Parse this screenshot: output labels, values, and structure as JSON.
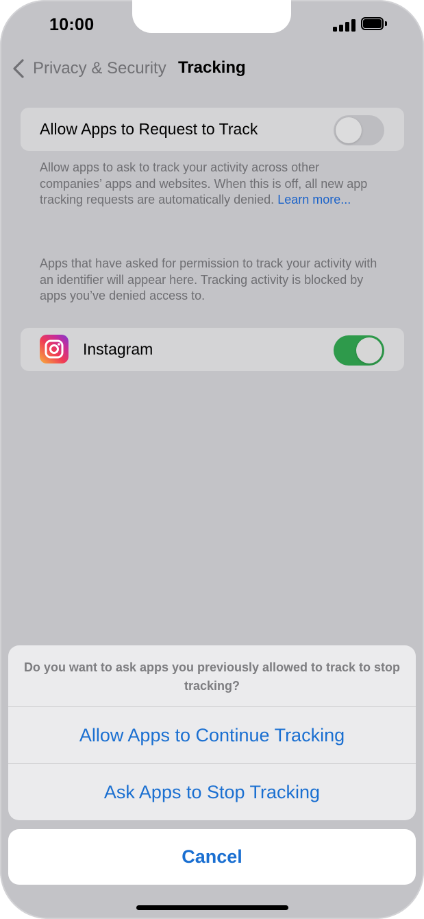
{
  "status_bar": {
    "time": "10:00",
    "signal_icon": "cellular-signal-icon",
    "battery_icon": "battery-full-icon"
  },
  "nav": {
    "back_label": "Privacy & Security",
    "title": "Tracking",
    "back_icon": "chevron-left-icon"
  },
  "allow_request": {
    "label": "Allow Apps to Request to Track",
    "enabled": false,
    "footnote": "Allow apps to ask to track your activity across other companies’ apps and websites. When this is off, all new app tracking requests are automatically denied. ",
    "learn_more": "Learn more..."
  },
  "apps_section": {
    "footnote": "Apps that have asked for permission to track your activity with an identifier will appear here. Tracking activity is blocked by apps you’ve denied access to.",
    "apps": [
      {
        "name": "Instagram",
        "icon": "instagram-icon",
        "enabled": true
      }
    ]
  },
  "action_sheet": {
    "message": "Do you want to ask apps you previously allowed to track to stop tracking?",
    "actions": [
      {
        "label": "Allow Apps to Continue Tracking"
      },
      {
        "label": "Ask Apps to Stop Tracking"
      }
    ],
    "cancel": "Cancel"
  },
  "colors": {
    "accent": "#1a6fd1",
    "toggle_on": "#2e9a4b",
    "dimmed_background": "#c3c3c7"
  }
}
